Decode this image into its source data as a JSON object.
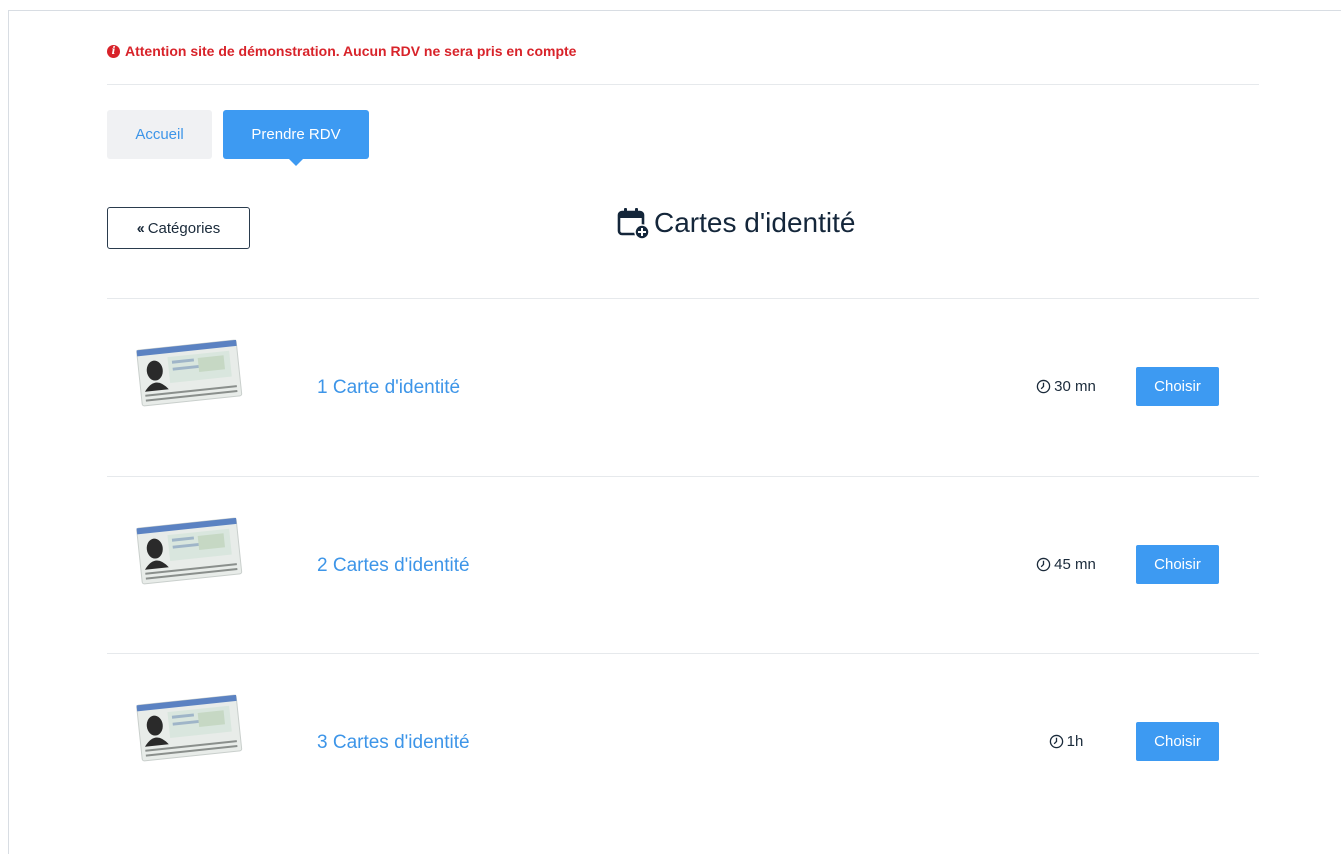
{
  "warning": {
    "icon": "info-circle-icon",
    "text": "Attention site de démonstration. Aucun RDV ne sera pris en compte",
    "color": "#d8232a"
  },
  "tabs": [
    {
      "label": "Accueil",
      "active": false
    },
    {
      "label": "Prendre RDV",
      "active": true
    }
  ],
  "back_button": {
    "label": "Catégories",
    "icon": "double-chevron-left-icon"
  },
  "page_title": {
    "icon": "calendar-plus-icon",
    "text": "Cartes d'identité"
  },
  "services": [
    {
      "name": "1 Carte d'identité",
      "duration": "30 mn",
      "button": "Choisir"
    },
    {
      "name": "2 Cartes d'identité",
      "duration": "45 mn",
      "button": "Choisir"
    },
    {
      "name": "3 Cartes d'identité",
      "duration": "1h",
      "button": "Choisir"
    }
  ],
  "colors": {
    "accent": "#3d9af2",
    "link": "#3d95e8",
    "title": "#14263a"
  }
}
